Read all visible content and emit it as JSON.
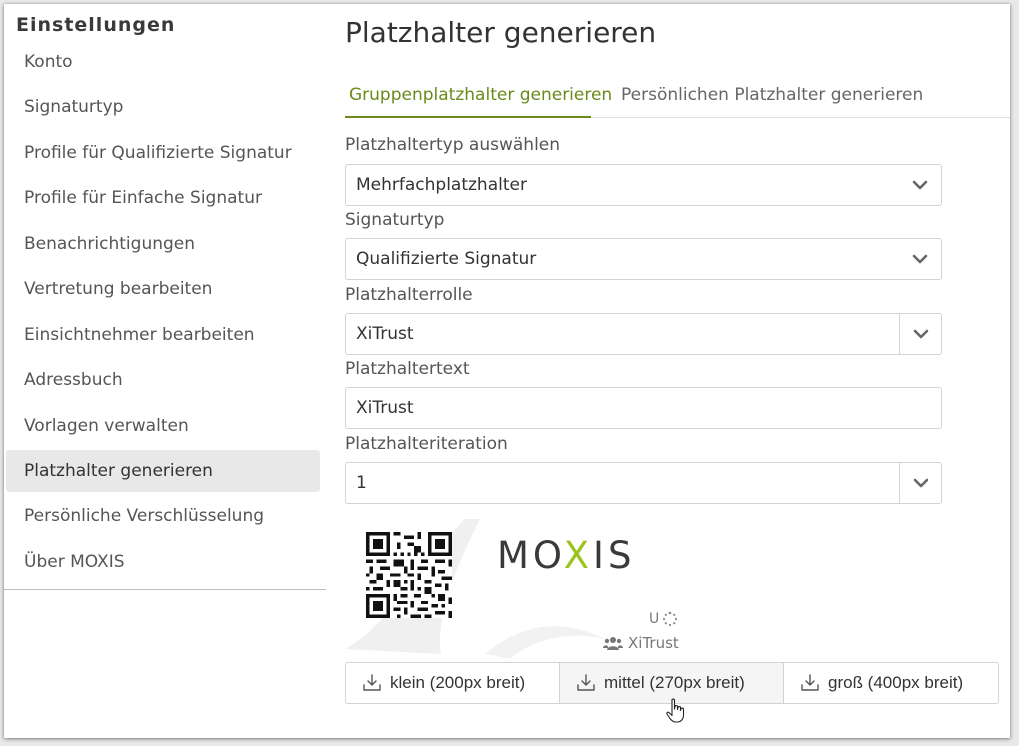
{
  "sidebar": {
    "title": "Einstellungen",
    "items": [
      {
        "label": "Konto"
      },
      {
        "label": "Signaturtyp"
      },
      {
        "label": "Profile für Qualifizierte Signatur"
      },
      {
        "label": "Profile für Einfache Signatur"
      },
      {
        "label": "Benachrichtigungen"
      },
      {
        "label": "Vertretung bearbeiten"
      },
      {
        "label": "Einsichtnehmer bearbeiten"
      },
      {
        "label": "Adressbuch"
      },
      {
        "label": "Vorlagen verwalten"
      },
      {
        "label": "Platzhalter generieren",
        "active": true
      },
      {
        "label": "Persönliche Verschlüsselung"
      },
      {
        "label": "Über MOXIS"
      }
    ]
  },
  "main": {
    "title": "Platzhalter generieren",
    "tabs": [
      {
        "label": "Gruppenplatzhalter generieren",
        "active": true
      },
      {
        "label": "Persönlichen Platzhalter generieren"
      }
    ],
    "fields": {
      "type": {
        "label": "Platzhaltertyp auswählen",
        "value": "Mehrfachplatzhalter"
      },
      "signature_type": {
        "label": "Signaturtyp",
        "value": "Qualifizierte Signatur"
      },
      "role": {
        "label": "Platzhalterrolle",
        "value": "XiTrust"
      },
      "text": {
        "label": "Platzhaltertext",
        "value": "XiTrust"
      },
      "iteration": {
        "label": "Platzhalteriteration",
        "value": "1"
      }
    },
    "preview": {
      "brand_left": "MO",
      "brand_x": "X",
      "brand_right": "IS",
      "user_initial": "U",
      "group_name": "XiTrust"
    },
    "downloads": [
      {
        "label": "klein (200px breit)"
      },
      {
        "label": "mittel (270px breit)"
      },
      {
        "label": "groß (400px breit)"
      }
    ]
  },
  "colors": {
    "accent": "#6b8a1a",
    "brand_green": "#9cc31f",
    "active_item_bg": "#e8e8e8"
  },
  "icons": [
    "chevron-down-icon",
    "download-icon",
    "group-icon",
    "spinner-icon",
    "qr-code",
    "hand-cursor-icon"
  ]
}
